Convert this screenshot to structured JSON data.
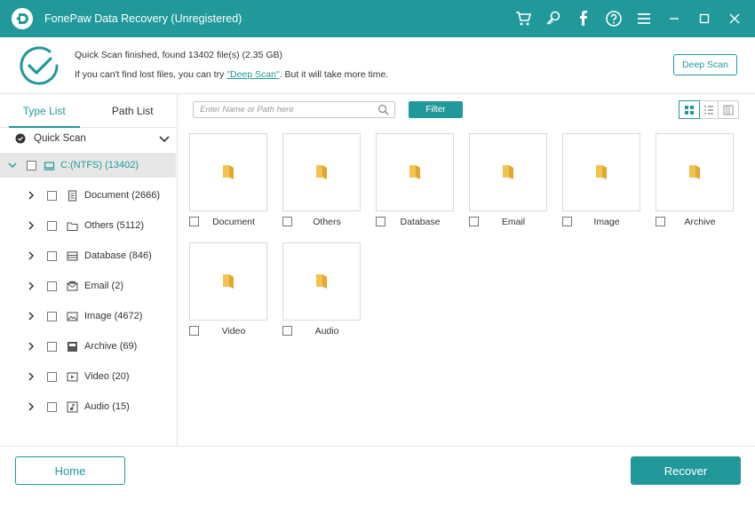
{
  "app": {
    "title": "FonePaw Data Recovery (Unregistered)",
    "accent_color": "#21999a",
    "titlebar_icons": [
      "cart-icon",
      "key-icon",
      "facebook-icon",
      "help-icon",
      "menu-icon",
      "minimize-icon",
      "maximize-icon",
      "close-icon"
    ]
  },
  "banner": {
    "status": "Quick Scan finished, found 13402 file(s) (2.35 GB)",
    "hint_before": "If you can't find lost files, you can try ",
    "hint_link": "\"Deep Scan\"",
    "hint_after": ". But it will take more time.",
    "deep_scan_button": "Deep Scan"
  },
  "sidebar": {
    "tabs": [
      {
        "label": "Type List",
        "active": true
      },
      {
        "label": "Path List",
        "active": false
      }
    ],
    "scan_mode": "Quick Scan",
    "root": {
      "label": "C:(NTFS) (13402)",
      "icon": "drive-icon"
    },
    "items": [
      {
        "label": "Document (2666)",
        "icon": "document-icon"
      },
      {
        "label": "Others (5112)",
        "icon": "folder-outline-icon"
      },
      {
        "label": "Database (846)",
        "icon": "database-icon"
      },
      {
        "label": "Email (2)",
        "icon": "email-icon"
      },
      {
        "label": "Image (4672)",
        "icon": "image-icon"
      },
      {
        "label": "Archive (69)",
        "icon": "archive-icon"
      },
      {
        "label": "Video (20)",
        "icon": "video-icon"
      },
      {
        "label": "Audio (15)",
        "icon": "audio-icon"
      }
    ]
  },
  "toolbar": {
    "search_placeholder": "Enter Name or Path here",
    "filter_button": "Filter",
    "views": [
      "grid-view-icon",
      "list-view-icon",
      "detail-view-icon"
    ],
    "active_view": "grid-view-icon"
  },
  "grid": {
    "folders": [
      {
        "label": "Document"
      },
      {
        "label": "Others"
      },
      {
        "label": "Database"
      },
      {
        "label": "Email"
      },
      {
        "label": "Image"
      },
      {
        "label": "Archive"
      },
      {
        "label": "Video"
      },
      {
        "label": "Audio"
      }
    ]
  },
  "footer": {
    "home_button": "Home",
    "recover_button": "Recover"
  }
}
